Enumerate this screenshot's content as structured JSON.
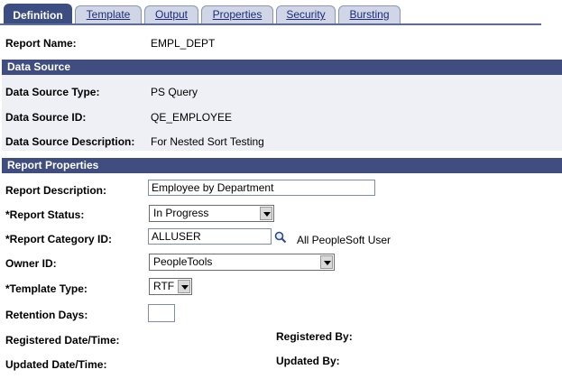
{
  "tabs": [
    {
      "label": "Definition",
      "active": true
    },
    {
      "label": "Template"
    },
    {
      "label": "Output"
    },
    {
      "label": "Properties"
    },
    {
      "label": "Security"
    },
    {
      "label": "Bursting"
    }
  ],
  "report_name": {
    "label": "Report Name:",
    "value": "EMPL_DEPT"
  },
  "data_source": {
    "header": "Data Source",
    "type_label": "Data Source Type:",
    "type_value": "PS Query",
    "id_label": "Data Source ID:",
    "id_value": "QE_EMPLOYEE",
    "desc_label": "Data Source Description:",
    "desc_value": "For Nested Sort Testing"
  },
  "report_properties": {
    "header": "Report Properties",
    "description_label": "Report Description:",
    "description_value": "Employee by Department",
    "status_label": "*Report Status:",
    "status_value": "In Progress",
    "category_label": "*Report Category ID:",
    "category_value": "ALLUSER",
    "category_desc": "All PeopleSoft User",
    "owner_label": "Owner ID:",
    "owner_value": "PeopleTools",
    "template_type_label": "*Template Type:",
    "template_type_value": "RTF",
    "retention_label": "Retention Days:",
    "retention_value": "",
    "registered_date_label": "Registered Date/Time:",
    "registered_by_label": "Registered By:",
    "updated_date_label": "Updated Date/Time:",
    "updated_by_label": "Updated By:"
  },
  "colors": {
    "tab_active": "#3c4d82",
    "section_header": "#3f4d81",
    "band": "#eef0f5"
  }
}
